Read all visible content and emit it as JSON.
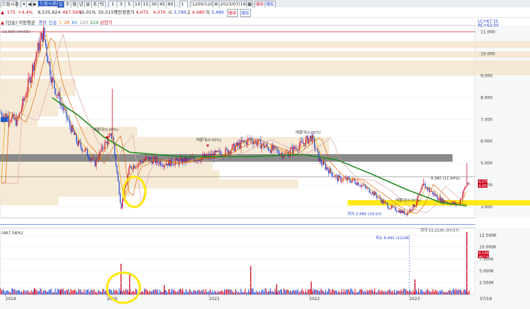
{
  "toolbar": {
    "symbol_value": "드림시큐",
    "stock_name": "드림시큐리",
    "period_buttons": [
      "일",
      "주",
      "월",
      "년",
      "분",
      "초",
      "틱"
    ],
    "minute_buttons": [
      "1",
      "3",
      "5",
      "10",
      "15",
      "30",
      "45",
      "60"
    ],
    "count_value": "1",
    "range_value": "1200/1200",
    "date_value": "2023/07/19",
    "buy_label": "매수",
    "sell_label": "매도"
  },
  "infobar": {
    "change": "175",
    "change_pct": "+4.4%",
    "volume": "8,535,924",
    "volume_pct": "467.56%",
    "turnover": "15.01%",
    "amount": "35,515백만",
    "close_label": "정종가",
    "close_value": "4,075",
    "open_label": "시",
    "open_value": "4,070",
    "high_label": "고",
    "high_value": "4,480",
    "low_label": "저",
    "low_value": "3,490",
    "low2": "3,790"
  },
  "price_legend": {
    "title": "(단순) 이동평균",
    "items": [
      "종가",
      "단순",
      "5",
      "20",
      "60",
      "120",
      "224"
    ],
    "upper": "상한가"
  },
  "vol_legend": "(467.56%)",
  "side_text": {
    "lc": "LC+67.15",
    "rc": "RC+63.00"
  },
  "colors": {
    "up": "#d0021b",
    "down": "#1a3fd1",
    "ma224": "#1f8a1f",
    "highlight": "#ffe800",
    "profile": "#f5e6cf"
  },
  "chart_data": {
    "type": "candlestick",
    "x_ticks": [
      "2019",
      "2020",
      "2021",
      "2022",
      "2023",
      "07/19"
    ],
    "y_price_ticks": [
      "11.000",
      "10.000",
      "9.000",
      "8.000",
      "7.000",
      "6.000",
      "5.000",
      "4.000",
      "3.000"
    ],
    "y_price_range": [
      2500,
      11300
    ],
    "y_volume_ticks": [
      "12.500K",
      "10.000K",
      "7.500K",
      "5.000K",
      "2.500K"
    ],
    "y_volume_range": [
      0,
      14000
    ],
    "price_path": [
      [
        "2019-01",
        7300
      ],
      [
        "2019-03",
        6900
      ],
      [
        "2019-04",
        8200
      ],
      [
        "2019-05",
        9700
      ],
      [
        "2019-06",
        11000
      ],
      [
        "2019-07",
        8800
      ],
      [
        "2019-08",
        7800
      ],
      [
        "2019-09",
        6800
      ],
      [
        "2019-10",
        5900
      ],
      [
        "2019-11",
        5500
      ],
      [
        "2019-12",
        5000
      ],
      [
        "2020-01",
        5800
      ],
      [
        "2020-02",
        6300
      ],
      [
        "2020-03",
        3000
      ],
      [
        "2020-04",
        4800
      ],
      [
        "2020-06",
        5200
      ],
      [
        "2020-08",
        5000
      ],
      [
        "2020-10",
        5100
      ],
      [
        "2020-12",
        5200
      ],
      [
        "2021-03",
        5500
      ],
      [
        "2021-06",
        6100
      ],
      [
        "2021-08",
        5700
      ],
      [
        "2021-10",
        5400
      ],
      [
        "2021-12",
        5900
      ],
      [
        "2022-01",
        6200
      ],
      [
        "2022-02",
        5100
      ],
      [
        "2022-04",
        4300
      ],
      [
        "2022-06",
        4200
      ],
      [
        "2022-08",
        3700
      ],
      [
        "2022-10",
        3000
      ],
      [
        "2022-12",
        2700
      ],
      [
        "2023-01",
        3100
      ],
      [
        "2023-02",
        4000
      ],
      [
        "2023-04",
        3300
      ],
      [
        "2023-06",
        3100
      ],
      [
        "2023-07",
        4080
      ]
    ],
    "ma224_path": [
      [
        "2019-07",
        8000
      ],
      [
        "2019-10",
        7200
      ],
      [
        "2020-01",
        6200
      ],
      [
        "2020-04",
        5500
      ],
      [
        "2020-10",
        5300
      ],
      [
        "2021-06",
        5300
      ],
      [
        "2021-12",
        5400
      ],
      [
        "2022-04",
        5150
      ],
      [
        "2022-08",
        4500
      ],
      [
        "2022-12",
        3800
      ],
      [
        "2023-04",
        3200
      ],
      [
        "2023-07",
        3050
      ]
    ],
    "annotations": [
      {
        "text": "11,000 (04/05)",
        "date": "2019-04",
        "price": 11000
      },
      {
        "text": "매물대(0.00%)",
        "date": "2020-01",
        "price": 6300
      },
      {
        "text": "매물대(0.00%)",
        "date": "2020-12",
        "price": 5800
      },
      {
        "text": "매물대(0.00%)",
        "date": "2022-01",
        "price": 6300
      },
      {
        "text": "매물대(0.00%)",
        "date": "2023-01",
        "price": 3100
      },
      {
        "text": "최저 2,580 (10/12)",
        "date": "2022-10",
        "price": 2580
      },
      {
        "text": "4,380 (11.94%)",
        "date": "2023-07",
        "price": 4380
      },
      {
        "text": "최소 6,491 (12/28)",
        "date": "2022-12",
        "volume": 6491
      },
      {
        "text": "최대 13,222K (07/17)",
        "date": "2023-07",
        "volume": 13222
      }
    ],
    "current_price_labels": [
      "4,075",
      "4.45%"
    ],
    "current_volume_labels": [
      "8,536K",
      "467.56%"
    ],
    "volume_spikes": [
      [
        "2019-05",
        1400
      ],
      [
        "2019-08",
        1000
      ],
      [
        "2020-03",
        6500
      ],
      [
        "2020-04",
        4200
      ],
      [
        "2020-08",
        2000
      ],
      [
        "2021-06",
        6000
      ],
      [
        "2021-09",
        2200
      ],
      [
        "2022-01",
        2800
      ],
      [
        "2023-01",
        3200
      ],
      [
        "2023-07",
        13222
      ]
    ],
    "gridlines": true
  }
}
